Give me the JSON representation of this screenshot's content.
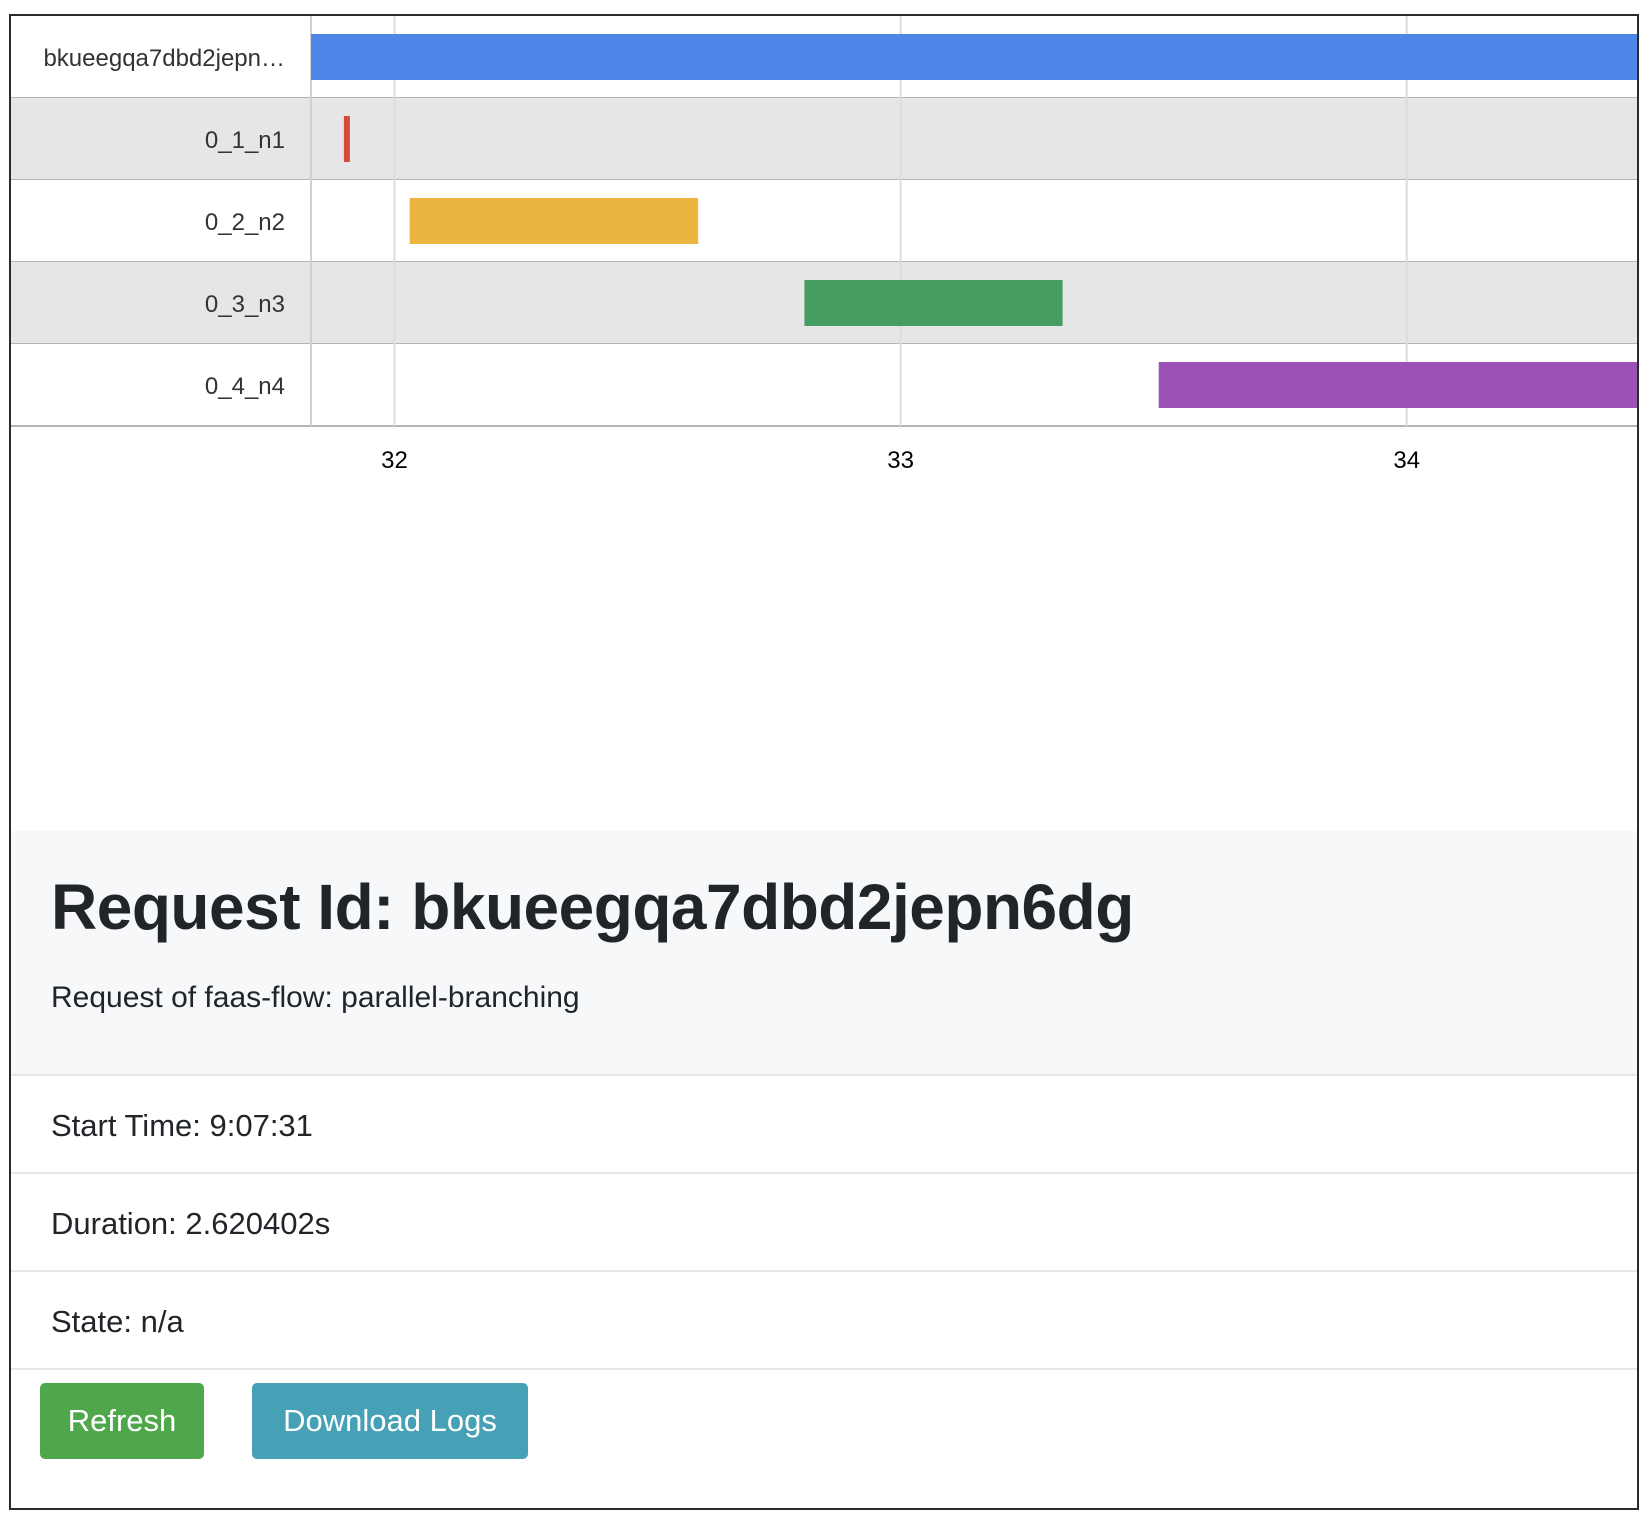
{
  "timeline": {
    "rows": [
      {
        "label": "bkueegqa7dbd2jepn…",
        "start": 31.835,
        "end": 34.455,
        "color": "#4f87e9"
      },
      {
        "label": "0_1_n1",
        "start": 31.9,
        "end": 31.91,
        "color": "#d24b3c"
      },
      {
        "label": "0_2_n2",
        "start": 32.03,
        "end": 32.6,
        "color": "#ebb53f"
      },
      {
        "label": "0_3_n3",
        "start": 32.81,
        "end": 33.32,
        "color": "#469d62"
      },
      {
        "label": "0_4_n4",
        "start": 33.51,
        "end": 34.455,
        "color": "#9c51b7"
      }
    ],
    "ticks": [
      "32",
      "33",
      "34"
    ],
    "tick_values": [
      32,
      33,
      34
    ],
    "x_range": [
      31.835,
      34.455
    ]
  },
  "request": {
    "title": "Request Id: bkueegqa7dbd2jepn6dg",
    "subtitle": "Request of faas-flow: parallel-branching",
    "start_time": "Start Time: 9:07:31",
    "duration": "Duration: 2.620402s",
    "state": "State: n/a"
  },
  "buttons": {
    "refresh": "Refresh",
    "download_logs": "Download Logs"
  }
}
